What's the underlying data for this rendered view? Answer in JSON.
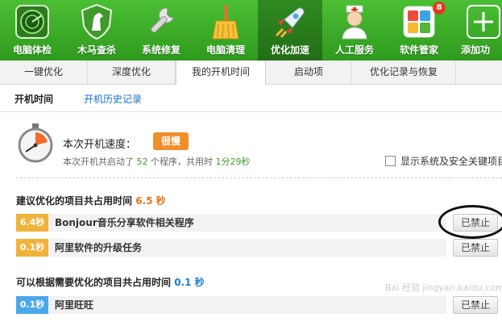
{
  "toolbar": {
    "items": [
      {
        "label": "电脑体检",
        "icon": "radar-icon"
      },
      {
        "label": "木马查杀",
        "icon": "horse-shield-icon"
      },
      {
        "label": "系统修复",
        "icon": "wrench-icon"
      },
      {
        "label": "电脑清理",
        "icon": "broom-icon"
      },
      {
        "label": "优化加速",
        "icon": "rocket-icon"
      },
      {
        "label": "人工服务",
        "icon": "doctor-icon"
      },
      {
        "label": "软件管家",
        "icon": "app-grid-icon",
        "badge": "8"
      },
      {
        "label": "添加功",
        "icon": "plus-icon"
      }
    ],
    "active_index": 4
  },
  "tabs": [
    "一键优化",
    "深度优化",
    "我的开机时间",
    "启动项",
    "优化记录与恢复"
  ],
  "active_tab": "我的开机时间",
  "subtabs": {
    "current": "开机时间",
    "history": "开机历史记录"
  },
  "summary": {
    "title": "本次开机速度：",
    "rating": "很慢",
    "text_prefix": "本次开机共启动了",
    "program_count": "52",
    "text_middle": "个程序，共用时",
    "duration": "1分29秒",
    "checkbox_label": "显示系统及安全关键项目"
  },
  "recommended": {
    "prefix": "建议优化的项目共占用时间",
    "time": "6.5 秒",
    "items": [
      {
        "time": "6.4秒",
        "name": "Bonjour音乐分享软件相关程序",
        "button": "已禁止"
      },
      {
        "time": "0.1秒",
        "name": "阿里软件的升级任务",
        "button": "已禁止"
      }
    ]
  },
  "optional": {
    "prefix": "可以根据需要优化的项目共占用时间",
    "time": "0.1 秒",
    "items": [
      {
        "time": "0.1秒",
        "name": "阿里旺旺",
        "button": "已禁止"
      }
    ]
  },
  "watermark": "Bai 经验  jingyan.baidu.com",
  "colors": {
    "toolbar_green": "#3aae27",
    "accent_orange": "#f08e2a",
    "tag_blue": "#4aa8e8",
    "link_blue": "#1a6fc9"
  }
}
